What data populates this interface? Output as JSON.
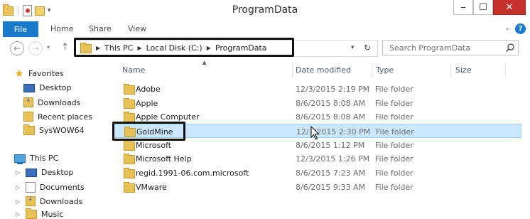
{
  "window": {
    "title": "ProgramData"
  },
  "ribbon": {
    "tabs": [
      "File",
      "Home",
      "Share",
      "View"
    ],
    "help": "?"
  },
  "address": {
    "crumbs": [
      "This PC",
      "Local Disk (C:)",
      "ProgramData"
    ]
  },
  "search": {
    "placeholder": "Search ProgramData"
  },
  "navpane": {
    "favorites_label": "Favorites",
    "favorites": [
      "Desktop",
      "Downloads",
      "Recent places",
      "SysWOW64"
    ],
    "thispc_label": "This PC",
    "thispc": [
      "Desktop",
      "Documents",
      "Downloads",
      "Music"
    ]
  },
  "columns": {
    "name": "Name",
    "date": "Date modified",
    "type": "Type",
    "size": "Size"
  },
  "files": [
    {
      "name": "Adobe",
      "date": "12/3/2015 2:19 PM",
      "type": "File folder"
    },
    {
      "name": "Apple",
      "date": "8/6/2015 8:08 AM",
      "type": "File folder"
    },
    {
      "name": "Apple Computer",
      "date": "8/6/2015 8:08 AM",
      "type": "File folder"
    },
    {
      "name": "GoldMine",
      "date": "12/3/2015 2:30 PM",
      "type": "File folder",
      "selected": true
    },
    {
      "name": "Microsoft",
      "date": "8/6/2015 1:12 PM",
      "type": "File folder"
    },
    {
      "name": "Microsoft Help",
      "date": "12/3/2015 1:26 PM",
      "type": "File folder"
    },
    {
      "name": "regid.1991-06.com.microsoft",
      "date": "8/6/2015 7:23 AM",
      "type": "File folder"
    },
    {
      "name": "VMware",
      "date": "8/6/2015 9:33 AM",
      "type": "File folder"
    }
  ],
  "colors": {
    "accent": "#1979ca",
    "selection": "#cce8ff",
    "close": "#c7312b",
    "folder": "#e8c058"
  }
}
